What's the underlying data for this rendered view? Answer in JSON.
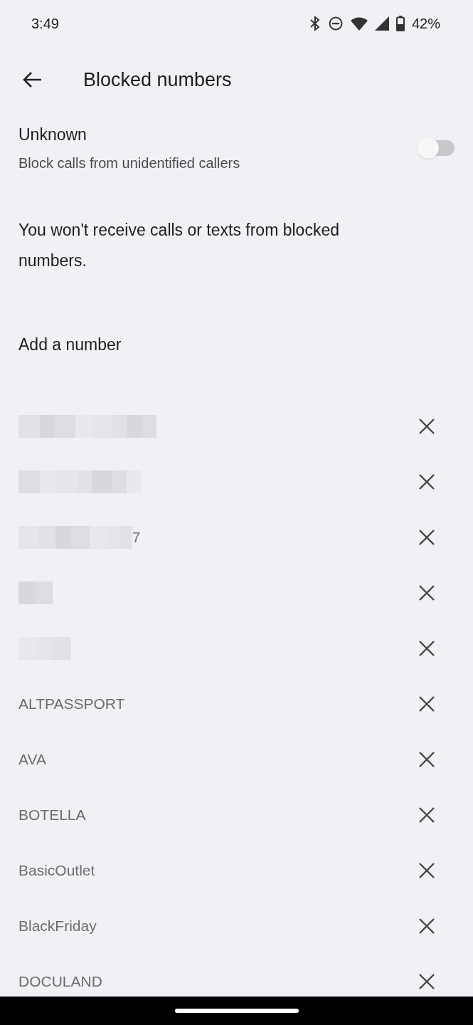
{
  "status_bar": {
    "time": "3:49",
    "battery": "42%"
  },
  "header": {
    "title": "Blocked numbers"
  },
  "unknown": {
    "title": "Unknown",
    "subtitle": "Block calls from unidentified callers",
    "on": false
  },
  "notice": "You won't receive calls or texts from blocked numbers.",
  "add_number": "Add a number",
  "blocked": [
    {
      "kind": "redacted"
    },
    {
      "kind": "redacted"
    },
    {
      "kind": "redacted",
      "text": "7"
    },
    {
      "kind": "redacted"
    },
    {
      "kind": "redacted"
    },
    {
      "kind": "name",
      "text": "ALTPASSPORT"
    },
    {
      "kind": "name",
      "text": "AVA"
    },
    {
      "kind": "name",
      "text": "BOTELLA"
    },
    {
      "kind": "name",
      "text": "BasicOutlet"
    },
    {
      "kind": "name",
      "text": "BlackFriday"
    },
    {
      "kind": "name",
      "text": "DOCULAND"
    }
  ]
}
